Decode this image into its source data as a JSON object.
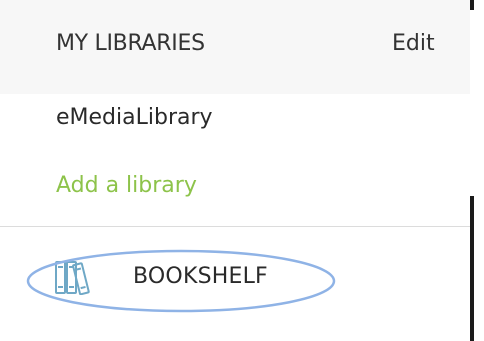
{
  "libraries": {
    "header_title": "MY LIBRARIES",
    "edit_label": "Edit",
    "items": [
      {
        "label": "eMediaLibrary"
      }
    ],
    "add_label": "Add a library"
  },
  "nav": {
    "bookshelf_label": "BOOKSHELF",
    "bookshelf_icon": "books-icon"
  },
  "colors": {
    "header_bg": "#f7f7f7",
    "text": "#2a2a2a",
    "accent_green": "#8dc34a",
    "icon_blue": "#6fa8c6",
    "highlight_oval": "#8fb3e6"
  }
}
